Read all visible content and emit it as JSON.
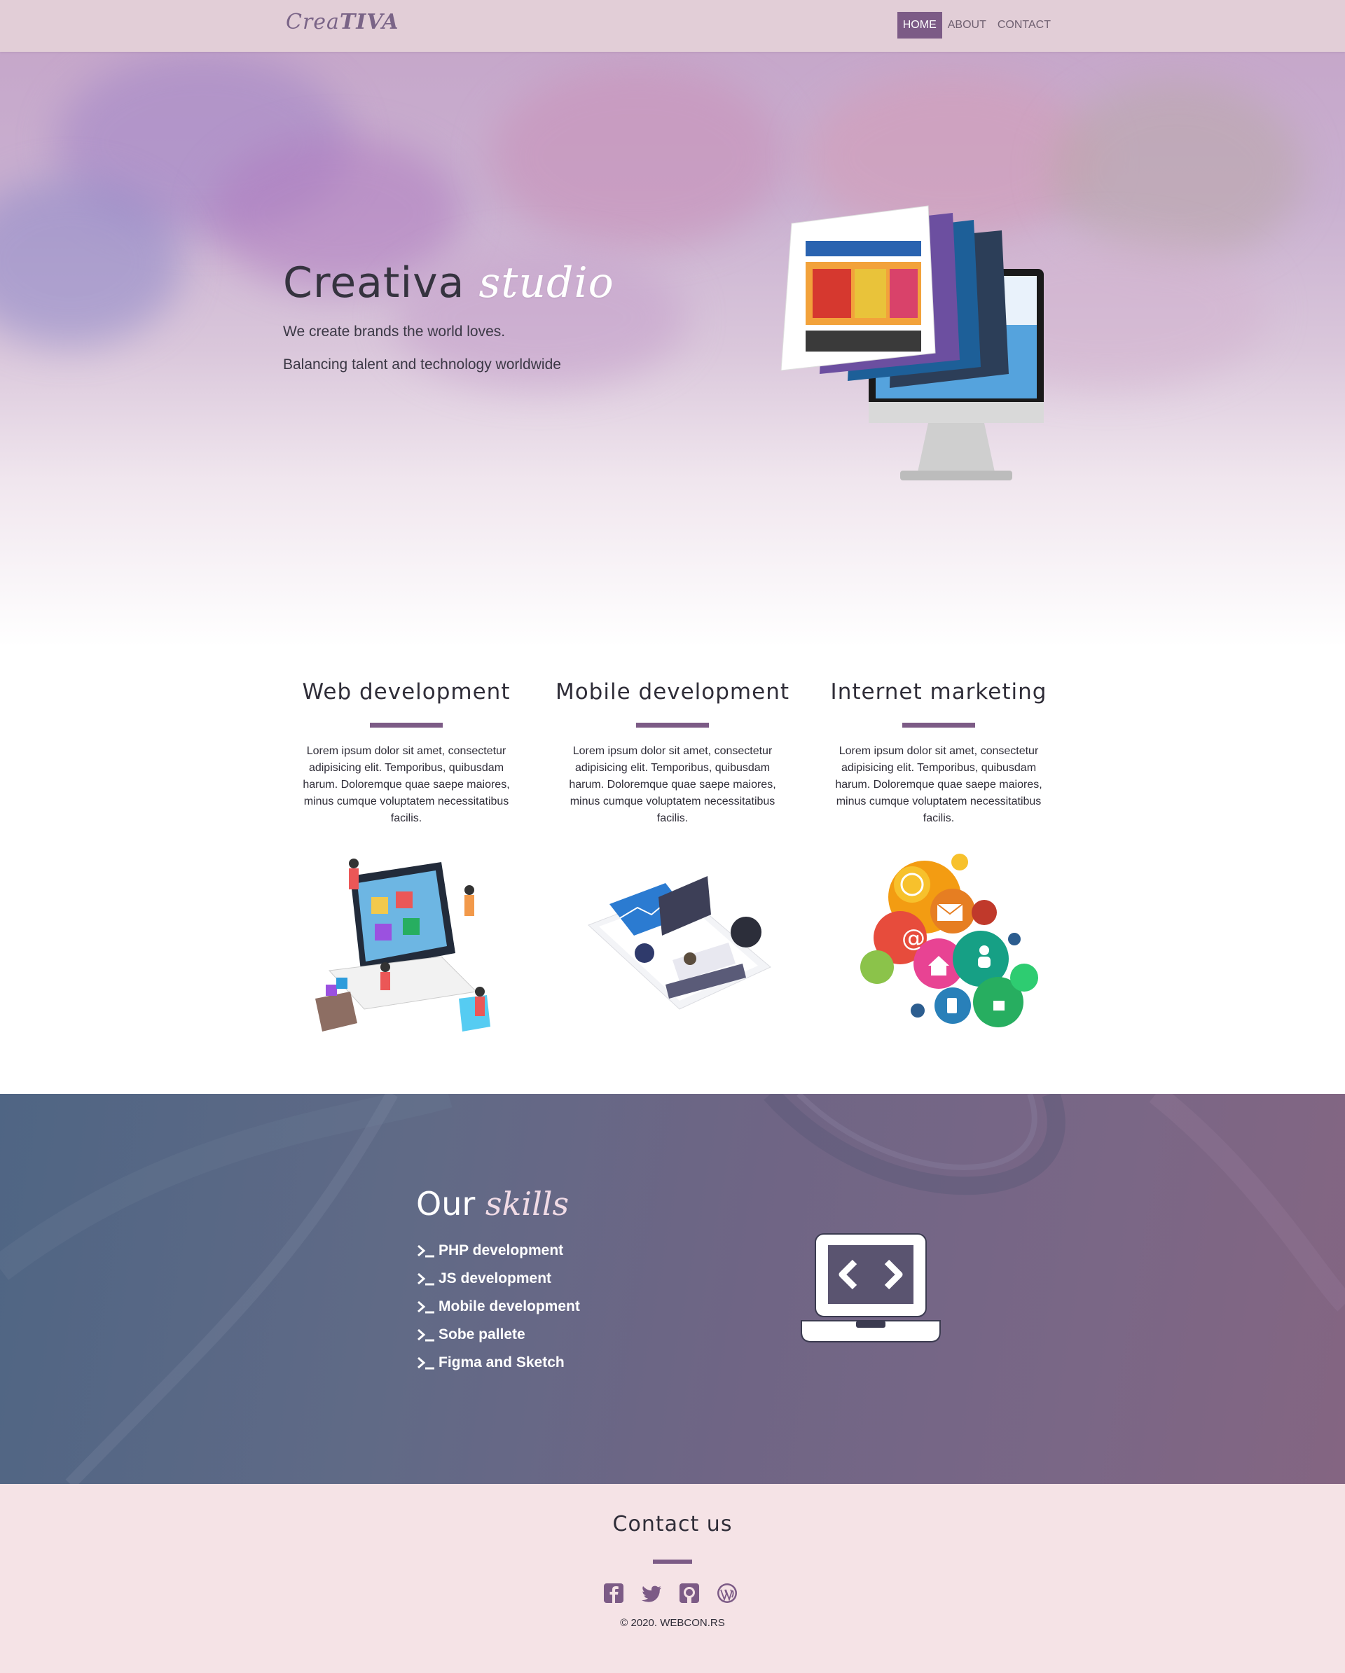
{
  "navbar": {
    "brand_light": "Crea",
    "brand_bold": "TIVA",
    "links": [
      {
        "label": "HOME",
        "active": true
      },
      {
        "label": "ABOUT",
        "active": false
      },
      {
        "label": "CONTACT",
        "active": false
      }
    ]
  },
  "hero": {
    "title_plain": "Creativa",
    "title_italic": "studio",
    "line1": "We create brands the world loves.",
    "line2": "Balancing talent and technology worldwide",
    "image_icon": "monitor-with-web-pages-icon"
  },
  "services": [
    {
      "title": "Web development",
      "text": "Lorem ipsum dolor sit amet, consectetur adipisicing elit. Temporibus, quibusdam harum. Doloremque quae saepe maiores, minus cumque voluptatem necessitatibus facilis.",
      "icon": "web-development-illustration-icon"
    },
    {
      "title": "Mobile development",
      "text": "Lorem ipsum dolor sit amet, consectetur adipisicing elit. Temporibus, quibusdam harum. Doloremque quae saepe maiores, minus cumque voluptatem necessitatibus facilis.",
      "icon": "mobile-development-illustration-icon"
    },
    {
      "title": "Internet marketing",
      "text": "Lorem ipsum dolor sit amet, consectetur adipisicing elit. Temporibus, quibusdam harum. Doloremque quae saepe maiores, minus cumque voluptatem necessitatibus facilis.",
      "icon": "internet-marketing-illustration-icon"
    }
  ],
  "skills": {
    "title_plain": "Our",
    "title_italic": "skills",
    "items": [
      "PHP development",
      "JS development",
      "Mobile development",
      "Sobe pallete",
      "Figma and Sketch"
    ],
    "icon": "laptop-code-icon"
  },
  "footer": {
    "title": "Contact us",
    "social_icons": [
      "facebook-icon",
      "twitter-icon",
      "github-icon",
      "wordpress-icon"
    ],
    "copyright": "© 2020. WEBCON.RS"
  },
  "colors": {
    "accent": "#7c5b86",
    "navbar_bg": "#e2ced7",
    "footer_bg": "#f5e3e6",
    "skills_gradient_start": "#4f6584",
    "skills_gradient_end": "#846582"
  }
}
